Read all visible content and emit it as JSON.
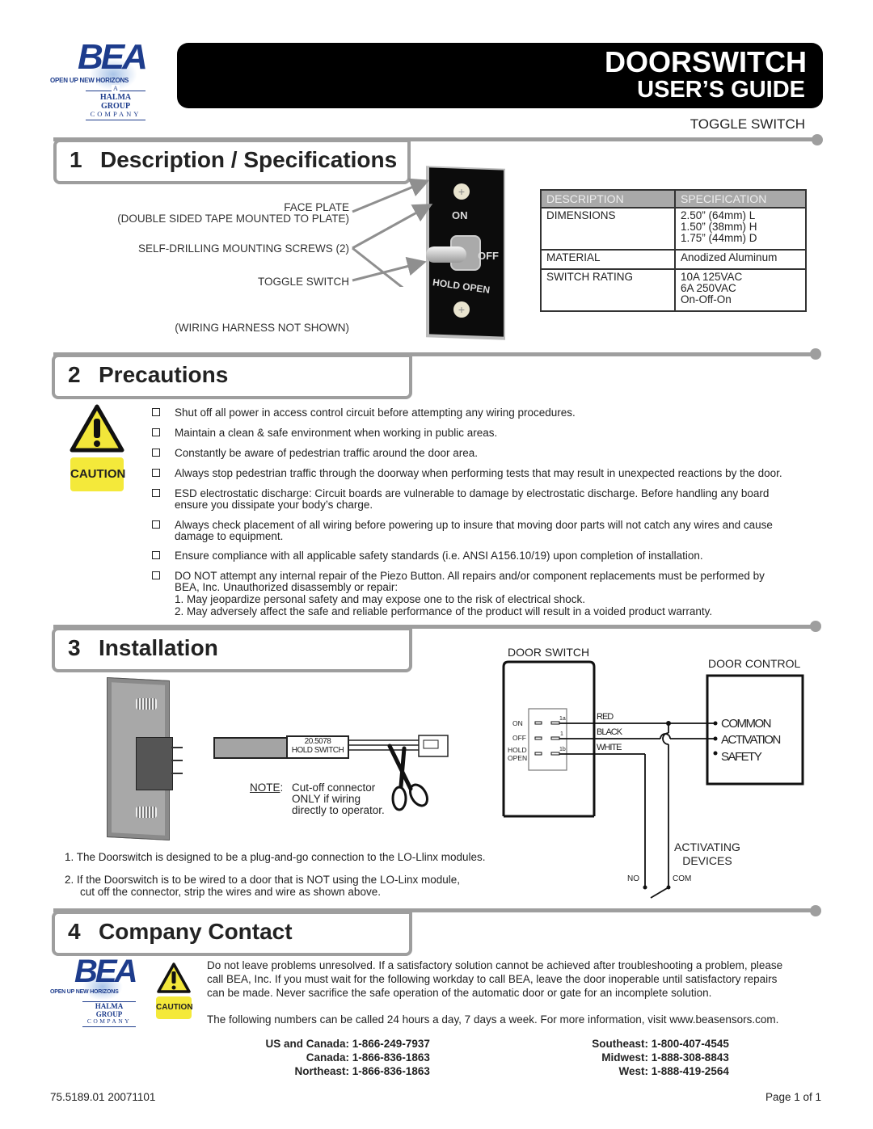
{
  "brand": {
    "logo_text": "BEA",
    "tagline": "OPEN UP NEW HORIZONS",
    "halma_a": "A",
    "halma_group": "HALMA GROUP",
    "halma_company": "COMPANY"
  },
  "header": {
    "title": "DOORSWITCH",
    "subtitle": "USER’S GUIDE",
    "product": "TOGGLE SWITCH"
  },
  "sections": {
    "s1": {
      "number": "1",
      "title": "Description / Specifications"
    },
    "s2": {
      "number": "2",
      "title": "Precautions"
    },
    "s3": {
      "number": "3",
      "title": "Installation"
    },
    "s4": {
      "number": "4",
      "title": "Company Contact"
    }
  },
  "description": {
    "labels": {
      "face_plate": "FACE PLATE",
      "face_plate_note": "(DOUBLE SIDED TAPE MOUNTED  TO PLATE)",
      "screws": "SELF-DRILLING MOUNTING SCREWS (2)",
      "toggle": "TOGGLE SWITCH",
      "harness": "(WIRING HARNESS  NOT SHOWN)"
    },
    "switch_markings": {
      "on": "ON",
      "off": "OFF",
      "hold_open": "HOLD OPEN"
    },
    "table": {
      "headers": [
        "DESCRIPTION",
        "SPECIFICATION"
      ],
      "rows": [
        {
          "desc": "DIMENSIONS",
          "spec": [
            "2.50” (64mm) L",
            "1.50” (38mm) H",
            "1.75” (44mm) D"
          ]
        },
        {
          "desc": "MATERIAL",
          "spec": [
            "Anodized Aluminum"
          ]
        },
        {
          "desc": "SWITCH RATING",
          "spec": [
            "10A 125VAC",
            "6A 250VAC",
            "On-Off-On"
          ]
        }
      ]
    }
  },
  "precautions": {
    "caution_label": "CAUTION",
    "items": [
      "Shut off all power in access control circuit before attempting any wiring procedures.",
      "Maintain a clean & safe environment when working in public areas.",
      "Constantly be aware of pedestrian traffic around the door area.",
      "Always stop pedestrian traffic through the doorway when performing tests that may result in unexpected reactions by the door.",
      "ESD electrostatic discharge: Circuit boards are vulnerable to damage by electrostatic discharge. Before handling any board",
      "ensure you dissipate your body’s charge.",
      "Always check placement of all wiring before powering up to insure that moving door parts will not catch any wires and cause",
      "damage to equipment.",
      "Ensure compliance with all applicable safety standards (i.e. ANSI A156.10/19) upon completion of installation.",
      "DO NOT attempt any internal repair of the Piezo Button. All repairs and/or component replacements must be performed by",
      "BEA, Inc. Unauthorized disassembly or repair:",
      "1.  May jeopardize personal safety and may expose one to the risk of electrical shock.",
      "2.  May adversely affect the safe and reliable performance of the product will result in a voided product warranty."
    ]
  },
  "installation": {
    "harness_label_1": "20.5078",
    "harness_label_2": "HOLD SWITCH",
    "note_label": "NOTE",
    "note_lines": [
      "Cut-off connector",
      "ONLY if wiring",
      "directly to operator."
    ],
    "steps": [
      "1.  The Doorswitch is designed to be a plug-and-go connection to the LO-Llinx modules.",
      "2.  If the Doorswitch is to be wired to a door that is NOT using the LO-Linx module,",
      "cut off the connector, strip the wires and wire as shown above."
    ],
    "diagram": {
      "door_switch": "DOOR SWITCH",
      "door_control": "DOOR CONTROL",
      "positions": [
        "ON",
        "OFF",
        "HOLD",
        "OPEN"
      ],
      "terminals": [
        "1a",
        "1",
        "1b"
      ],
      "wires": [
        "RED",
        "BLACK",
        "WHITE"
      ],
      "control_terminals": [
        "COMMON",
        "ACTIVATION",
        "SAFETY"
      ],
      "activating_1": "ACTIVATING",
      "activating_2": "DEVICES",
      "no": "NO",
      "com": "COM"
    }
  },
  "contact": {
    "caution_label": "CAUTION",
    "para1": [
      "Do not leave problems unresolved. If a satisfactory solution cannot be achieved after troubleshooting a problem, please",
      "call BEA, Inc.  If you must wait for the following workday to call BEA, leave the door inoperable until satisfactory repairs",
      "can be made.   Never sacrifice the safe operation of the automatic door or gate for an incomplete solution."
    ],
    "para2": "The following numbers can be called 24 hours a day, 7 days a week.  For more information, visit www.beasensors.com.",
    "phones_left": [
      {
        "region": "US and Canada:",
        "number": "1-866-249-7937"
      },
      {
        "region": "Canada:",
        "number": "1-866-836-1863"
      },
      {
        "region": "Northeast:",
        "number": "1-866-836-1863"
      }
    ],
    "phones_right": [
      {
        "region": "Southeast:",
        "number": "1-800-407-4545"
      },
      {
        "region": "Midwest:",
        "number": "1-888-308-8843"
      },
      {
        "region": "West:",
        "number": "1-888-419-2564"
      }
    ]
  },
  "footer": {
    "doc_number": "75.5189.01 20071101",
    "page": "Page 1 of 1"
  }
}
